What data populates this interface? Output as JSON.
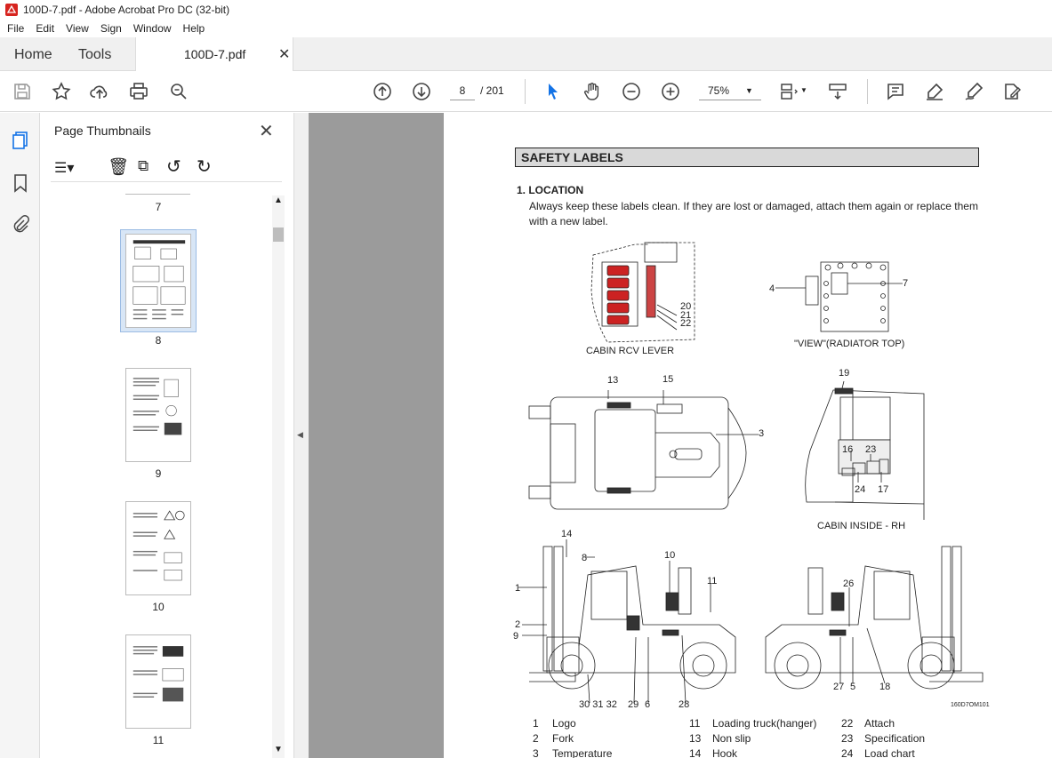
{
  "window": {
    "title": "100D-7.pdf - Adobe Acrobat Pro DC (32-bit)"
  },
  "menu": [
    "File",
    "Edit",
    "View",
    "Sign",
    "Window",
    "Help"
  ],
  "tabs": {
    "home": "Home",
    "tools": "Tools",
    "doc": "100D-7.pdf"
  },
  "toolbar": {
    "page_current": "8",
    "page_total": "/ 201",
    "zoom": "75%"
  },
  "thumbnails": {
    "title": "Page Thumbnails",
    "pages": [
      "7",
      "8",
      "9",
      "10",
      "11"
    ]
  },
  "document": {
    "section_title": "SAFETY LABELS",
    "heading": "1. LOCATION",
    "paragraph": "Always keep these labels clean.  If they are lost or damaged, attach them again or replace them with a new label.",
    "captions": {
      "cabin_rcv": "CABIN RCV LEVER",
      "radiator": "\"VIEW\"(RADIATOR TOP)",
      "cabin_inside": "CABIN INSIDE - RH",
      "drawing_code": "160D7OM101"
    },
    "callouts": [
      "20",
      "21",
      "22",
      "4",
      "7",
      "13",
      "15",
      "3",
      "19",
      "16",
      "23",
      "24",
      "17",
      "14",
      "8",
      "10",
      "11",
      "1",
      "2",
      "9",
      "30 31 32",
      "29",
      "6",
      "28",
      "26",
      "27",
      "5",
      "18"
    ],
    "legend": [
      {
        "n": "1",
        "t": "Logo"
      },
      {
        "n": "11",
        "t": "Loading truck(hanger)"
      },
      {
        "n": "22",
        "t": "Attach"
      },
      {
        "n": "2",
        "t": "Fork"
      },
      {
        "n": "13",
        "t": "Non slip"
      },
      {
        "n": "23",
        "t": "Specification"
      },
      {
        "n": "3",
        "t": "Temperature"
      },
      {
        "n": "14",
        "t": "Hook"
      },
      {
        "n": "24",
        "t": "Load chart"
      }
    ]
  }
}
